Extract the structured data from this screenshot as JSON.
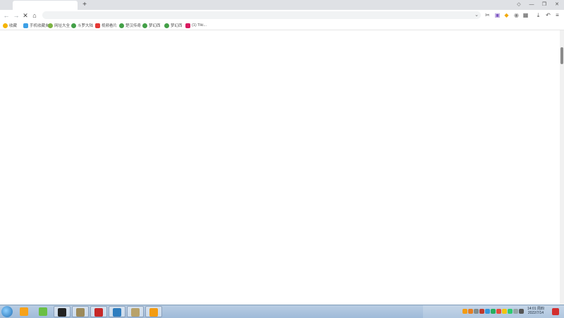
{
  "browser": {
    "tab_title": "",
    "new_tab_glyph": "+",
    "controls": {
      "minimize": "—",
      "restore": "❐",
      "close": "✕"
    },
    "nav": {
      "back": "←",
      "forward": "→",
      "stop": "✕",
      "home": "⌂"
    },
    "address_value": "",
    "address_chevron": "⌄"
  },
  "extensions": [
    {
      "name": "scissors-icon",
      "glyph": "✂",
      "color": "#555555"
    },
    {
      "name": "purple-ext-icon",
      "glyph": "▣",
      "color": "#7e57c2"
    },
    {
      "name": "shield-ext-icon",
      "glyph": "◆",
      "color": "#f2a900"
    },
    {
      "name": "game-ext-icon",
      "glyph": "◉",
      "color": "#888888"
    },
    {
      "name": "apps-grid-icon",
      "glyph": "▦",
      "color": "#555555"
    },
    {
      "name": "download-icon",
      "glyph": "⤓",
      "color": "#555555"
    },
    {
      "name": "undo-icon",
      "glyph": "↶",
      "color": "#555555"
    },
    {
      "name": "menu-icon",
      "glyph": "≡",
      "color": "#555555"
    }
  ],
  "bookmarks": [
    {
      "label": "收藏",
      "icon": "star-icon",
      "color": "#f5b400"
    },
    {
      "label": "手机收藏夹",
      "icon": "phone-icon",
      "color": "#3da0e6"
    },
    {
      "label": "网址大全",
      "icon": "globe-icon",
      "color": "#7cb342"
    },
    {
      "label": "斗罗大陆",
      "icon": "site-icon",
      "color": "#43a047"
    },
    {
      "label": "视频看片",
      "icon": "video-icon",
      "color": "#e53935"
    },
    {
      "label": "楚汉传奇",
      "icon": "site-icon",
      "color": "#43a047"
    },
    {
      "label": "梦幻西",
      "icon": "site-icon",
      "color": "#43a047"
    },
    {
      "label": "梦幻西",
      "icon": "site-icon",
      "color": "#43a047"
    },
    {
      "label": "(1) Tiki...",
      "icon": "tiki-icon",
      "color": "#d81b60"
    }
  ],
  "taskbar": {
    "apps": [
      {
        "name": "ie-app",
        "color": "#f6a21a",
        "active": false
      },
      {
        "name": "browser-app",
        "color": "#6abf45",
        "active": false
      },
      {
        "name": "media-app",
        "color": "#222222",
        "active": true
      },
      {
        "name": "game-app",
        "color": "#9c8a5b",
        "active": true
      },
      {
        "name": "tool-app",
        "color": "#c62828",
        "active": true
      },
      {
        "name": "chat-app",
        "color": "#2e7dbf",
        "active": true
      },
      {
        "name": "owl-app",
        "color": "#b8a26a",
        "active": true
      },
      {
        "name": "help-app",
        "color": "#f39c12",
        "active": true
      }
    ],
    "tray_colors": [
      "#f39c12",
      "#e67e22",
      "#7f8c8d",
      "#c0392b",
      "#3498db",
      "#27ae60",
      "#e74c3c",
      "#f1c40f",
      "#2ecc71",
      "#95a5a6",
      "#555555"
    ],
    "clock_time": "14:01 周四",
    "clock_date": "2022/7/14"
  }
}
